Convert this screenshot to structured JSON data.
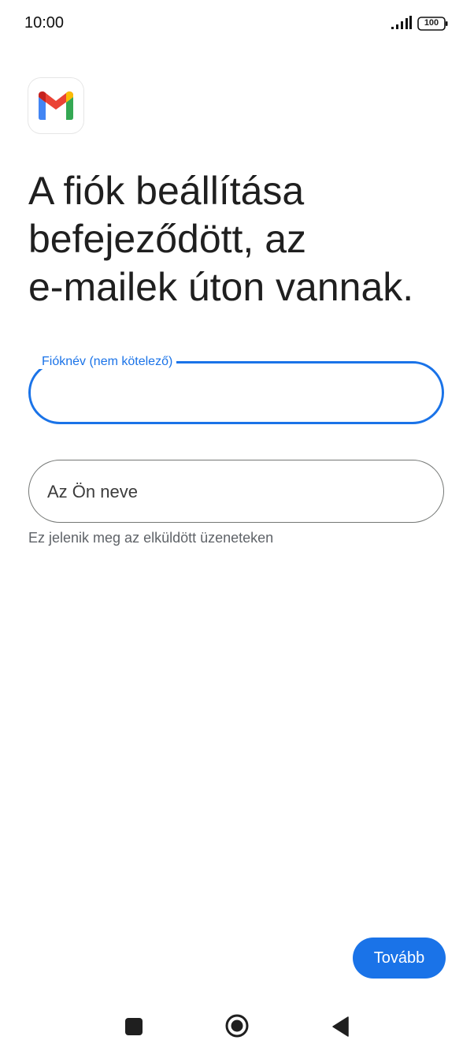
{
  "status_bar": {
    "time": "10:00",
    "battery": "100",
    "icons": [
      "signal-icon",
      "battery-icon"
    ]
  },
  "app": {
    "logo_icon": "gmail-logo-icon"
  },
  "headline": "A fiók beállítása\nbefejeződött, az\ne-mailek úton vannak.",
  "form": {
    "account_name": {
      "label": "Fióknév (nem kötelező)",
      "value": ""
    },
    "your_name": {
      "placeholder": "Az Ön neve",
      "value": "",
      "helper": "Ez jelenik meg az elküldött üzeneteken"
    }
  },
  "actions": {
    "next_label": "Tovább"
  },
  "nav_bar": {
    "icons": [
      "recents-icon",
      "home-icon",
      "back-icon"
    ]
  },
  "colors": {
    "accent": "#1a73e8",
    "text": "#1f1f1f",
    "helper": "#5f6368",
    "gmail_red": "#ea4335",
    "gmail_blue": "#4285f4",
    "gmail_green": "#34a853",
    "gmail_yellow": "#fbbc04",
    "gmail_darkred": "#c5221f"
  }
}
